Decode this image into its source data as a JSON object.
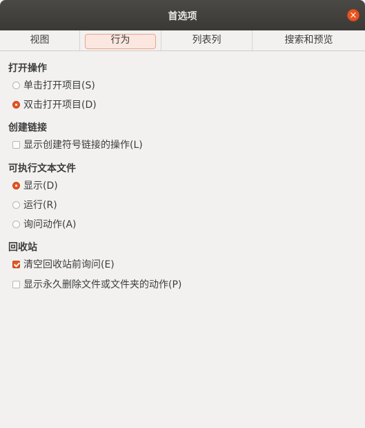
{
  "window": {
    "title": "首选项"
  },
  "tabs": [
    {
      "label": "视图",
      "active": false
    },
    {
      "label": "行为",
      "active": true
    },
    {
      "label": "列表列",
      "active": false
    },
    {
      "label": "搜索和预览",
      "active": false
    }
  ],
  "sections": {
    "open": {
      "title": "打开操作",
      "options": [
        {
          "label": "单击打开项目(S)",
          "checked": false
        },
        {
          "label": "双击打开项目(D)",
          "checked": true
        }
      ]
    },
    "links": {
      "title": "创建链接",
      "options": [
        {
          "label": "显示创建符号链接的操作(L)",
          "checked": false
        }
      ]
    },
    "executable": {
      "title": "可执行文本文件",
      "options": [
        {
          "label": "显示(D)",
          "checked": true
        },
        {
          "label": "运行(R)",
          "checked": false
        },
        {
          "label": "询问动作(A)",
          "checked": false
        }
      ]
    },
    "trash": {
      "title": "回收站",
      "options": [
        {
          "label": "清空回收站前询问(E)",
          "checked": true
        },
        {
          "label": "显示永久删除文件或文件夹的动作(P)",
          "checked": false
        }
      ]
    }
  },
  "colors": {
    "accent": "#e95420",
    "titlebar": "#3e3d39",
    "background": "#f2f1f0"
  },
  "icons": {
    "close": "close-icon"
  }
}
